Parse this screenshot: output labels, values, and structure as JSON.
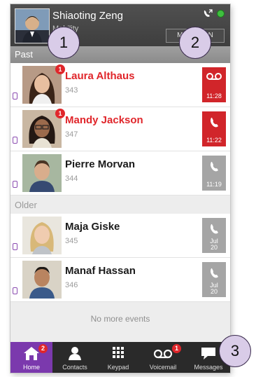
{
  "header": {
    "user_name": "Shiaoting Zeng",
    "status_text": "Mobility",
    "button_label": "Mobility ON"
  },
  "sections": {
    "past": "Past",
    "older": "Older"
  },
  "calls": [
    {
      "name": "Laura Althaus",
      "ext": "343",
      "time": "11:28",
      "type": "voicemail",
      "missed": true,
      "badge": "1",
      "tile_color": "#d1252a"
    },
    {
      "name": "Mandy Jackson",
      "ext": "347",
      "time": "11:22",
      "type": "phone",
      "missed": true,
      "badge": "1",
      "tile_color": "#d1252a"
    },
    {
      "name": "Pierre Morvan",
      "ext": "344",
      "time": "11:19",
      "type": "phone",
      "missed": false,
      "badge": null,
      "tile_color": "#a5a5a5"
    },
    {
      "name": "Maja Giske",
      "ext": "345",
      "date_month": "Jul",
      "date_day": "20",
      "type": "phone",
      "missed": false,
      "badge": null,
      "tile_color": "#a5a5a5"
    },
    {
      "name": "Manaf Hassan",
      "ext": "346",
      "date_month": "Jul",
      "date_day": "20",
      "type": "phone",
      "missed": false,
      "badge": null,
      "tile_color": "#a5a5a5"
    }
  ],
  "footer_text": "No more events",
  "tabs": [
    {
      "label": "Home",
      "icon": "home-icon",
      "badge": "2",
      "active": true
    },
    {
      "label": "Contacts",
      "icon": "contacts-icon",
      "badge": null,
      "active": false
    },
    {
      "label": "Keypad",
      "icon": "keypad-icon",
      "badge": null,
      "active": false
    },
    {
      "label": "Voicemail",
      "icon": "voicemail-icon",
      "badge": "1",
      "active": false
    },
    {
      "label": "Messages",
      "icon": "messages-icon",
      "badge": null,
      "active": false
    }
  ],
  "callouts": [
    "1",
    "2",
    "3"
  ],
  "colors": {
    "accent_purple": "#7b39ad",
    "missed_red": "#e0262b",
    "presence_green": "#3fbf3f"
  }
}
